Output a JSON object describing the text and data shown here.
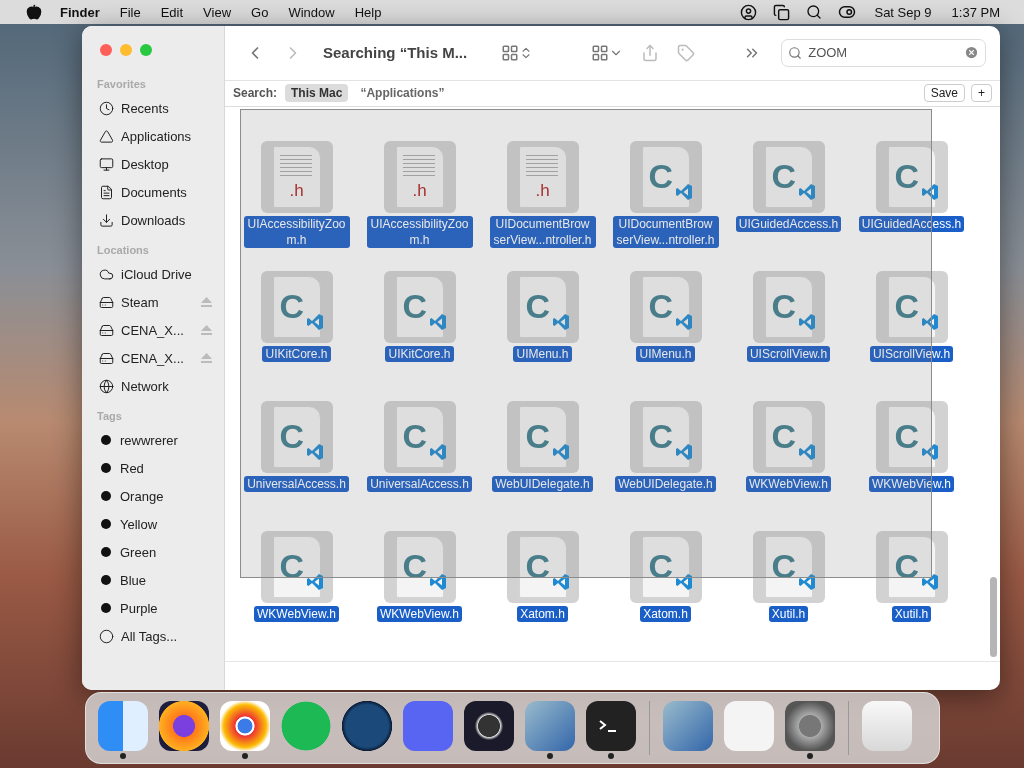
{
  "menubar": {
    "app": "Finder",
    "menus": [
      "File",
      "Edit",
      "View",
      "Go",
      "Window",
      "Help"
    ],
    "date": "Sat Sep 9",
    "time": "1:37 PM"
  },
  "window": {
    "title": "Searching “This M...",
    "search": {
      "value": "ZOOM"
    }
  },
  "scope_bar": {
    "label": "Search:",
    "scopes": [
      {
        "label": "This Mac",
        "selected": true
      },
      {
        "label": "“Applications”",
        "selected": false
      }
    ],
    "save": "Save",
    "add": "+"
  },
  "sidebar": {
    "sections": [
      {
        "title": "Favorites",
        "items": [
          {
            "label": "Recents",
            "kind": "clock",
            "selected": false
          },
          {
            "label": "Applications",
            "kind": "apps",
            "selected": false
          },
          {
            "label": "Desktop",
            "kind": "desktop",
            "selected": false
          },
          {
            "label": "Documents",
            "kind": "doc",
            "selected": false
          },
          {
            "label": "Downloads",
            "kind": "download",
            "selected": false
          }
        ]
      },
      {
        "title": "Locations",
        "items": [
          {
            "label": "iCloud Drive",
            "kind": "cloud",
            "selected": false
          },
          {
            "label": "Steam",
            "kind": "disk",
            "eject": true,
            "selected": false
          },
          {
            "label": "CENA_X...",
            "kind": "disk",
            "eject": true,
            "selected": false
          },
          {
            "label": "CENA_X...",
            "kind": "disk",
            "eject": true,
            "selected": false
          },
          {
            "label": "Network",
            "kind": "globe",
            "selected": false
          }
        ]
      },
      {
        "title": "Tags",
        "items": [
          {
            "label": "rewwrerer",
            "kind": "tag",
            "selected": false
          },
          {
            "label": "Red",
            "kind": "tag",
            "selected": false
          },
          {
            "label": "Orange",
            "kind": "tag",
            "selected": false
          },
          {
            "label": "Yellow",
            "kind": "tag",
            "selected": false
          },
          {
            "label": "Green",
            "kind": "tag",
            "selected": false
          },
          {
            "label": "Blue",
            "kind": "tag",
            "selected": false
          },
          {
            "label": "Purple",
            "kind": "tag",
            "selected": false
          },
          {
            "label": "All Tags...",
            "kind": "alltags",
            "selected": false
          }
        ]
      }
    ]
  },
  "files": [
    {
      "name": "UIAccessibilityZoom.h",
      "kind": "header",
      "icon_text": ".h",
      "selected": true
    },
    {
      "name": "UIAccessibilityZoom.h",
      "kind": "header",
      "icon_text": ".h",
      "selected": true
    },
    {
      "name": "UIDocumentBrowserView...ntroller.h",
      "kind": "header",
      "icon_text": ".h",
      "selected": true
    },
    {
      "name": "UIDocumentBrowserView...ntroller.h",
      "kind": "c-source",
      "icon_text": "C",
      "selected": true
    },
    {
      "name": "UIGuidedAccess.h",
      "kind": "c-source",
      "icon_text": "C",
      "selected": true
    },
    {
      "name": "UIGuidedAccess.h",
      "kind": "c-source",
      "icon_text": "C",
      "selected": true
    },
    {
      "name": "UIKitCore.h",
      "kind": "c-source",
      "icon_text": "C",
      "selected": true
    },
    {
      "name": "UIKitCore.h",
      "kind": "c-source",
      "icon_text": "C",
      "selected": true
    },
    {
      "name": "UIMenu.h",
      "kind": "c-source",
      "icon_text": "C",
      "selected": true
    },
    {
      "name": "UIMenu.h",
      "kind": "c-source",
      "icon_text": "C",
      "selected": true
    },
    {
      "name": "UIScrollView.h",
      "kind": "c-source",
      "icon_text": "C",
      "selected": true
    },
    {
      "name": "UIScrollView.h",
      "kind": "c-source",
      "icon_text": "C",
      "selected": true
    },
    {
      "name": "UniversalAccess.h",
      "kind": "c-source",
      "icon_text": "C",
      "selected": true
    },
    {
      "name": "UniversalAccess.h",
      "kind": "c-source",
      "icon_text": "C",
      "selected": true
    },
    {
      "name": "WebUIDelegate.h",
      "kind": "c-source",
      "icon_text": "C",
      "selected": true
    },
    {
      "name": "WebUIDelegate.h",
      "kind": "c-source",
      "icon_text": "C",
      "selected": true
    },
    {
      "name": "WKWebView.h",
      "kind": "c-source",
      "icon_text": "C",
      "selected": true
    },
    {
      "name": "WKWebView.h",
      "kind": "c-source",
      "icon_text": "C",
      "selected": true
    },
    {
      "name": "WKWebView.h",
      "kind": "c-source",
      "icon_text": "C",
      "selected": true
    },
    {
      "name": "WKWebView.h",
      "kind": "c-source",
      "icon_text": "C",
      "selected": true
    },
    {
      "name": "Xatom.h",
      "kind": "c-source",
      "icon_text": "C",
      "selected": true
    },
    {
      "name": "Xatom.h",
      "kind": "c-source",
      "icon_text": "C",
      "selected": true
    },
    {
      "name": "Xutil.h",
      "kind": "c-source",
      "icon_text": "C",
      "selected": true
    },
    {
      "name": "Xutil.h",
      "kind": "c-source",
      "icon_text": "C",
      "selected": true
    }
  ],
  "dock": [
    {
      "kind": "finder",
      "running": true
    },
    {
      "kind": "firefox",
      "running": false
    },
    {
      "kind": "chrome",
      "running": true
    },
    {
      "kind": "spotify",
      "running": false
    },
    {
      "kind": "steam",
      "running": false
    },
    {
      "kind": "discord",
      "running": false
    },
    {
      "kind": "obs",
      "running": false
    },
    {
      "kind": "virtualbox",
      "running": true
    },
    {
      "kind": "terminal",
      "running": true
    },
    {
      "kind": "separator"
    },
    {
      "kind": "virtualbox",
      "running": false
    },
    {
      "kind": "sysinfo",
      "running": false
    },
    {
      "kind": "settings",
      "running": true
    },
    {
      "kind": "separator"
    },
    {
      "kind": "trash",
      "running": false
    }
  ]
}
